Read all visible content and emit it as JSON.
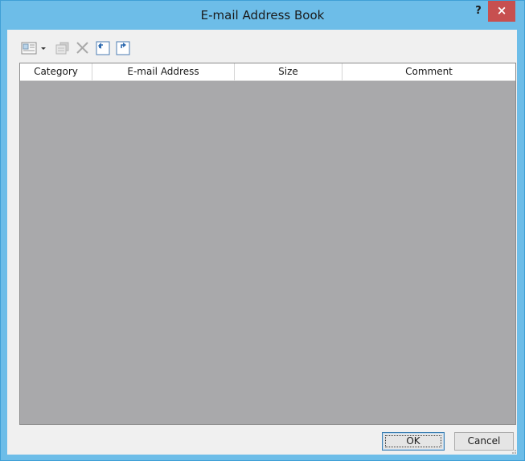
{
  "window": {
    "title": "E-mail Address Book",
    "help_label": "?",
    "close_label": "×"
  },
  "toolbar": {
    "buttons": [
      {
        "name": "address-book-view-icon",
        "enabled": true
      },
      {
        "name": "dropdown-arrow-icon",
        "enabled": true
      },
      {
        "name": "properties-icon",
        "enabled": false
      },
      {
        "name": "delete-icon",
        "enabled": false
      },
      {
        "name": "import-icon",
        "enabled": true
      },
      {
        "name": "export-icon",
        "enabled": true
      }
    ]
  },
  "table": {
    "columns": [
      "Category",
      "E-mail Address",
      "Size",
      "Comment"
    ],
    "rows": []
  },
  "buttons": {
    "ok_label": "OK",
    "cancel_label": "Cancel"
  },
  "colors": {
    "title_bar": "#6dbde8",
    "close_button": "#c75050",
    "grid_background": "#a9a9ab",
    "dialog_background": "#f0f0f0"
  }
}
